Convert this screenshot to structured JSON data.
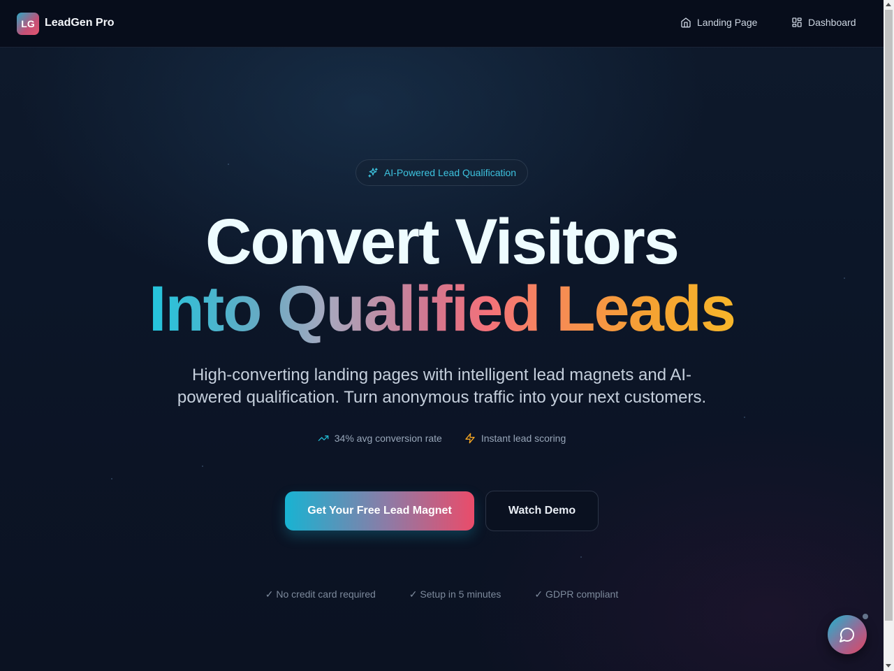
{
  "header": {
    "logo": "LG",
    "brand": "LeadGen Pro",
    "nav": [
      {
        "label": "Landing Page",
        "icon": "home-icon"
      },
      {
        "label": "Dashboard",
        "icon": "dashboard-icon"
      }
    ]
  },
  "hero": {
    "badge": "AI-Powered Lead Qualification",
    "headline_line1": "Convert Visitors",
    "headline_line2": "Into Qualified Leads",
    "subheadline": "High-converting landing pages with intelligent lead magnets and AI-powered qualification. Turn anonymous traffic into your next customers.",
    "stats": [
      {
        "label": "34% avg conversion rate",
        "icon": "trending-up-icon",
        "color": "#22b8cf"
      },
      {
        "label": "Instant lead scoring",
        "icon": "lightning-icon",
        "color": "#f5a623"
      }
    ],
    "primary_cta": "Get Your Free Lead Magnet",
    "secondary_cta": "Watch Demo",
    "trust": [
      "✓ No credit card required",
      "✓ Setup in 5 minutes",
      "✓ GDPR compliant"
    ]
  },
  "chat": {
    "icon": "chat-bubble-icon"
  },
  "colors": {
    "background": "#0b1224",
    "accent_cyan": "#22c5dd",
    "accent_pink": "#ea4c6a",
    "accent_orange": "#f7b62a"
  }
}
